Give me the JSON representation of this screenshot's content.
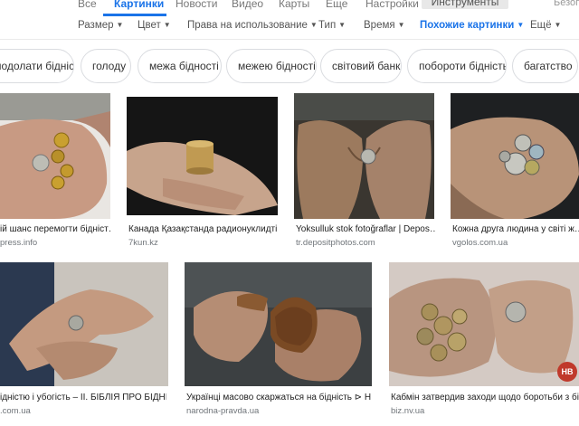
{
  "nav": {
    "tabs": [
      "Все",
      "Картинки",
      "Новости",
      "Видео",
      "Карты",
      "Еще",
      "Настройки"
    ],
    "tools_label": "Инструменты",
    "safe_search": "Безопасны"
  },
  "filters": {
    "size": "Размер",
    "color": "Цвет",
    "rights": "Права на использование",
    "type": "Тип",
    "time": "Время",
    "similar": "Похожие картинки",
    "more": "Ещё"
  },
  "chips": [
    "подолати бідність",
    "голоду",
    "межа бідності",
    "межею бідності",
    "світовий банк",
    "побороти бідність",
    "багатство"
  ],
  "row1": [
    {
      "caption": "ій шанс перемогти бідніст…",
      "source": "press.info"
    },
    {
      "caption": "Канада Қазақстанда радионуклидті…",
      "source": "7kun.kz"
    },
    {
      "caption": "Yoksulluk stok fotoğraflar | Depos…",
      "source": "tr.depositphotos.com"
    },
    {
      "caption": "Кожна друга людина у світі ж…",
      "source": "vgolos.com.ua"
    }
  ],
  "row2": [
    {
      "caption": "ідністю і убогість – ІІ. БІБЛІЯ ПРО БІДНІ…",
      "source": ".com.ua"
    },
    {
      "caption": "Українці масово скаржаться на бідність ⊳ Н…",
      "source": "narodna-pravda.ua"
    },
    {
      "caption": "Кабмін затвердив заходи щодо боротьби з бі…",
      "source": "biz.nv.ua",
      "badge": "НВ"
    }
  ],
  "colors": {
    "accent": "#1a73e8",
    "badge": "#c0392b"
  }
}
